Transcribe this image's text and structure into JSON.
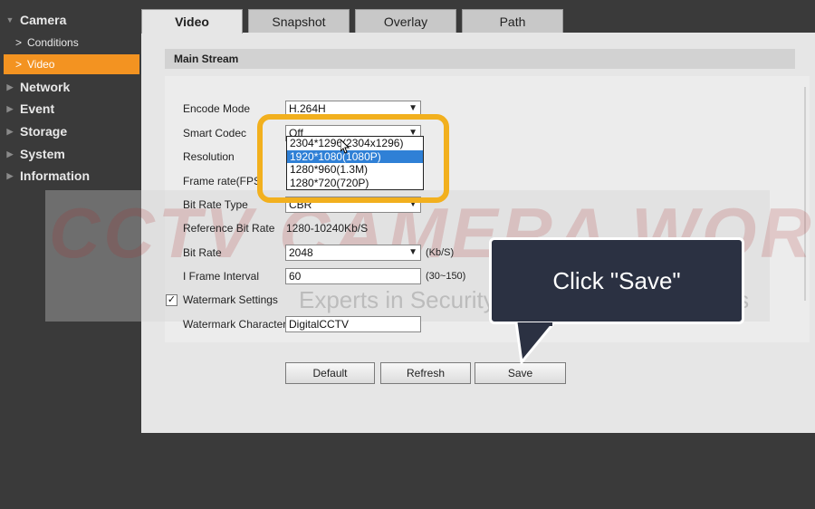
{
  "sidebar": {
    "camera": "Camera",
    "conditions": "Conditions",
    "video": "Video",
    "network": "Network",
    "event": "Event",
    "storage": "Storage",
    "system": "System",
    "information": "Information"
  },
  "tabs": {
    "video": "Video",
    "snapshot": "Snapshot",
    "overlay": "Overlay",
    "path": "Path"
  },
  "section_title": "Main Stream",
  "form": {
    "encode_mode_label": "Encode Mode",
    "encode_mode_value": "H.264H",
    "smart_codec_label": "Smart Codec",
    "smart_codec_value": "Off",
    "resolution_label": "Resolution",
    "frame_rate_label": "Frame rate(FPS",
    "bit_rate_type_label": "Bit Rate Type",
    "bit_rate_type_value": "CBR",
    "reference_bit_rate_label": "Reference Bit Rate",
    "reference_bit_rate_value": "1280-10240Kb/S",
    "bit_rate_label": "Bit Rate",
    "bit_rate_value": "2048",
    "bit_rate_unit": "(Kb/S)",
    "i_frame_label": "I Frame Interval",
    "i_frame_value": "60",
    "i_frame_range": "(30~150)",
    "watermark_settings_label": "Watermark Settings",
    "watermark_checked": true,
    "watermark_character_label": "Watermark Character",
    "watermark_character_value": "DigitalCCTV"
  },
  "resolution_options": [
    "2304*1296(2304x1296)",
    "1920*1080(1080P)",
    "1280*960(1.3M)",
    "1280*720(720P)"
  ],
  "resolution_selected_index": 1,
  "buttons": {
    "default": "Default",
    "refresh": "Refresh",
    "save": "Save"
  },
  "callout_text": "Click \"Save\"",
  "watermark": {
    "title": "CCTV CAMERA WORLD",
    "tagline": "Experts in Security & Surveillance Systems"
  },
  "colors": {
    "active_nav": "#f39321",
    "highlight": "#f2b01e",
    "selected_option": "#2f80d6",
    "callout_bg": "#2b3142"
  }
}
